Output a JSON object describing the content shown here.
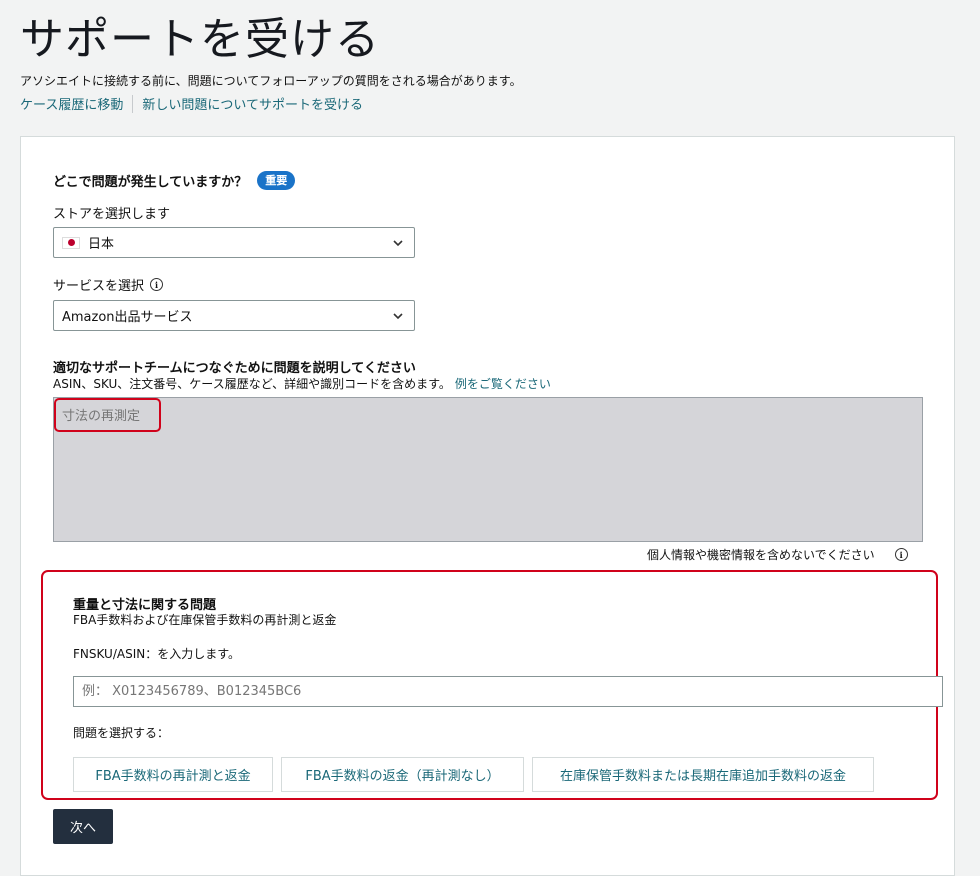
{
  "header": {
    "title": "サポートを受ける",
    "subtitle": "アソシエイトに接続する前に、問題についてフォローアップの質問をされる場合があります。",
    "links": [
      "ケース履歴に移動",
      "新しい問題についてサポートを受ける"
    ]
  },
  "form": {
    "question_label": "どこで問題が発生していますか？",
    "badge": "重要",
    "store_label": "ストアを選択します",
    "store_value": "日本",
    "service_label": "サービスを選択",
    "service_value": "Amazon出品サービス",
    "description_title": "適切なサポートチームにつなぐために問題を説明してください",
    "description_hint": "ASIN、SKU、注文番号、ケース履歴など、詳細や識別コードを含めます。",
    "description_example_link": "例をご覧ください",
    "description_value": "寸法の再測定",
    "privacy_note": "個人情報や機密情報を含めないでください"
  },
  "issue": {
    "title": "重量と寸法に関する問題",
    "subtitle": "FBA手数料および在庫保管手数料の再計測と返金",
    "fnsku_label": "FNSKU/ASIN：を入力します。",
    "fnsku_placeholder": "例： X0123456789、B012345BC6",
    "select_label": "問題を選択する：",
    "options": [
      "FBA手数料の再計測と返金",
      "FBA手数料の返金（再計測なし）",
      "在庫保管手数料または長期在庫追加手数料の返金"
    ]
  },
  "next_button": "次へ",
  "colors": {
    "accent_link": "#1a6878",
    "badge": "#1a73c8",
    "highlight": "#d0021b",
    "primary_button": "#232f3e"
  },
  "icons": [
    "japan-flag-icon",
    "chevron-down-icon",
    "info-icon"
  ]
}
